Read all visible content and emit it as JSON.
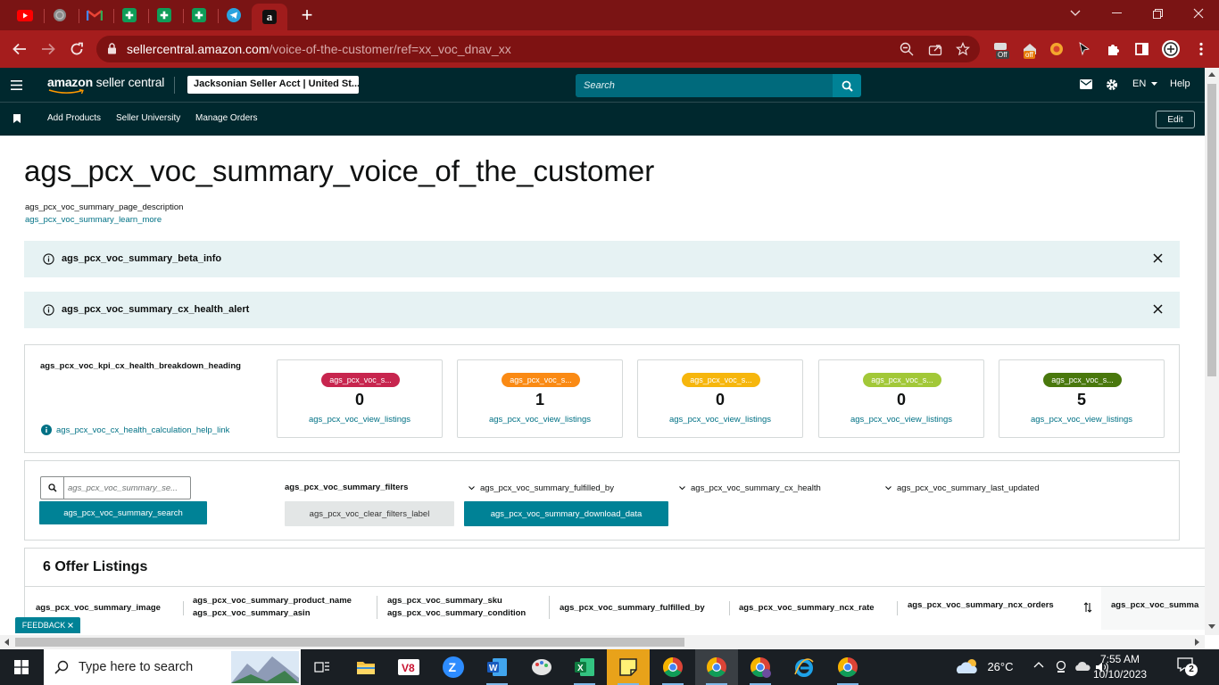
{
  "browser": {
    "tabs": [
      {
        "icon": "youtube-icon",
        "color": "#ff0000"
      },
      {
        "icon": "globe-icon",
        "color": "#9a9a9a"
      },
      {
        "icon": "gmail-icon",
        "color": "#ea4335"
      },
      {
        "icon": "sheets-icon",
        "color": "#0f9d58"
      },
      {
        "icon": "sheets-icon",
        "color": "#0f9d58"
      },
      {
        "icon": "sheets-icon",
        "color": "#0f9d58"
      },
      {
        "icon": "telegram-icon",
        "color": "#2aa3df"
      },
      {
        "icon": "amazon-icon",
        "color": "#000000"
      }
    ],
    "new_tab_label": "+",
    "url_host": "sellercentral.amazon.com",
    "url_path": "/voice-of-the-customer/ref=xx_voc_dnav_xx",
    "ext_badge_off_1": "Off",
    "ext_badge_off_2": "off"
  },
  "header": {
    "logo_brand": "amazon",
    "logo_text": "seller central",
    "account": "Jacksonian Seller Acct | United St...",
    "search_placeholder": "Search",
    "language": "EN",
    "help": "Help"
  },
  "subnav": {
    "links": [
      "Add Products",
      "Seller University",
      "Manage Orders"
    ],
    "edit": "Edit"
  },
  "page": {
    "title": "ags_pcx_voc_summary_voice_of_the_customer",
    "description": "ags_pcx_voc_summary_page_description",
    "learn_more": "ags_pcx_voc_summary_learn_more"
  },
  "alerts": [
    {
      "text": "ags_pcx_voc_summary_beta_info"
    },
    {
      "text": "ags_pcx_voc_summary_cx_health_alert"
    }
  ],
  "kpi": {
    "heading": "ags_pcx_voc_kpi_cx_health_breakdown_heading",
    "help_link": "ags_pcx_voc_cx_health_calculation_help_link",
    "cards": [
      {
        "badge": "ags_pcx_voc_s...",
        "value": "0",
        "link": "ags_pcx_voc_view_listings",
        "color": "#c7254e"
      },
      {
        "badge": "ags_pcx_voc_s...",
        "value": "1",
        "link": "ags_pcx_voc_view_listings",
        "color": "#fa8a14"
      },
      {
        "badge": "ags_pcx_voc_s...",
        "value": "0",
        "link": "ags_pcx_voc_view_listings",
        "color": "#f6b60d"
      },
      {
        "badge": "ags_pcx_voc_s...",
        "value": "0",
        "link": "ags_pcx_voc_view_listings",
        "color": "#a2c838"
      },
      {
        "badge": "ags_pcx_voc_s...",
        "value": "5",
        "link": "ags_pcx_voc_view_listings",
        "color": "#49780d"
      }
    ]
  },
  "filters": {
    "search_placeholder": "ags_pcx_voc_summary_se...",
    "search_button": "ags_pcx_voc_summary_search",
    "label": "ags_pcx_voc_summary_filters",
    "clear": "ags_pcx_voc_clear_filters_label",
    "download": "ags_pcx_voc_summary_download_data",
    "dropdowns": [
      "ags_pcx_voc_summary_fulfilled_by",
      "ags_pcx_voc_summary_cx_health",
      "ags_pcx_voc_summary_last_updated"
    ]
  },
  "listings": {
    "title": "6 Offer Listings",
    "columns": {
      "image": "ags_pcx_voc_summary_image",
      "product_name": "ags_pcx_voc_summary_product_name",
      "asin": "ags_pcx_voc_summary_asin",
      "sku": "ags_pcx_voc_summary_sku",
      "condition": "ags_pcx_voc_summary_condition",
      "fulfilled_by": "ags_pcx_voc_summary_fulfilled_by",
      "ncx_rate": "ags_pcx_voc_summary_ncx_rate",
      "ncx_orders": "ags_pcx_voc_summary_ncx_orders",
      "next": "ags_pcx_voc_summa"
    }
  },
  "feedback": "FEEDBACK",
  "taskbar": {
    "search_placeholder": "Type here to search",
    "weather": "26°C",
    "time": "7:55 AM",
    "date": "10/10/2023",
    "notifications": "2"
  }
}
